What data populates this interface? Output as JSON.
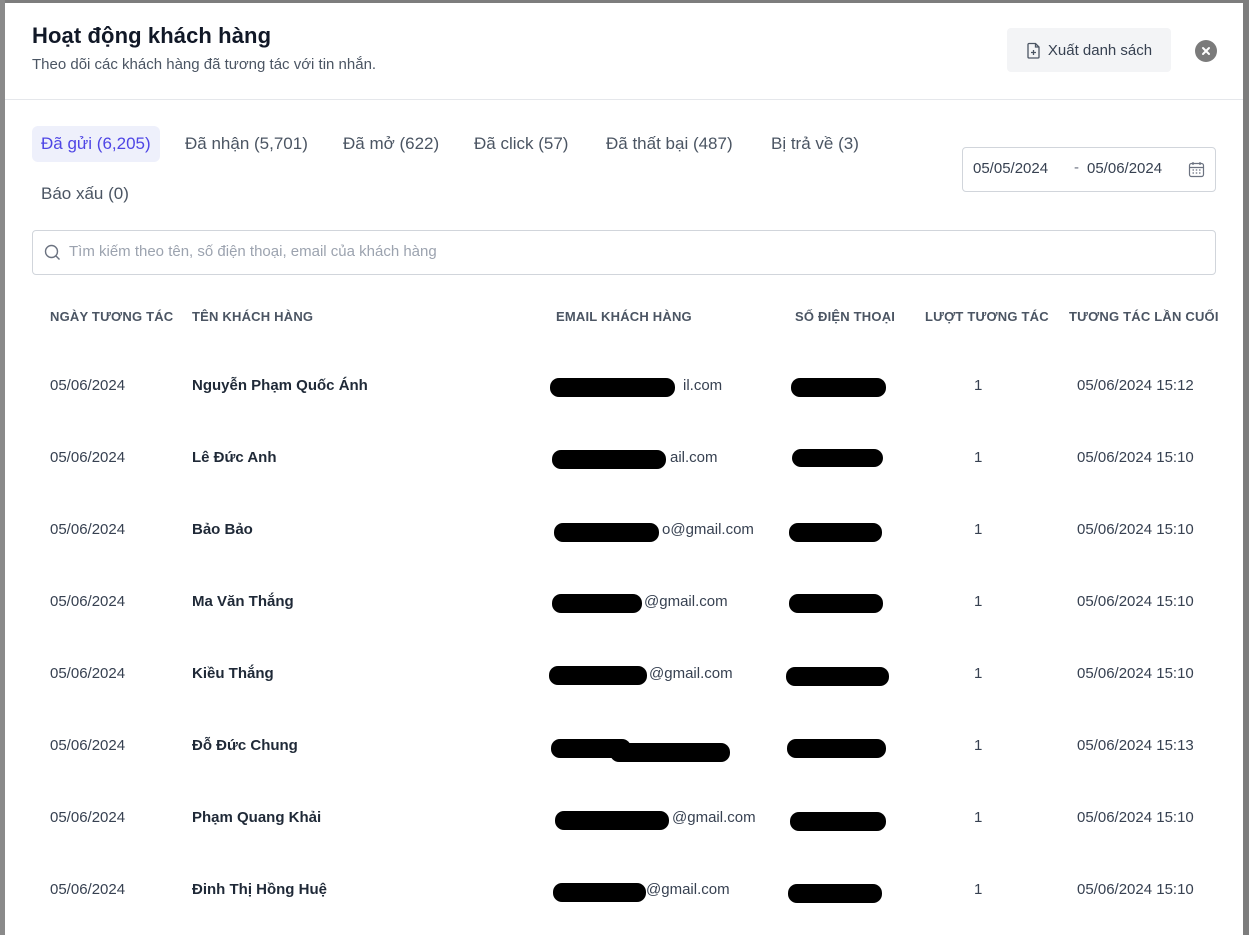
{
  "modal": {
    "title": "Hoạt động khách hàng",
    "subtitle": "Theo dõi các khách hàng đã tương tác với tin nhắn.",
    "export_label": "Xuất danh sách"
  },
  "tabs": [
    {
      "label": "Đã gửi (6,205)",
      "active": true
    },
    {
      "label": "Đã nhận (5,701)",
      "active": false
    },
    {
      "label": "Đã mở (622)",
      "active": false
    },
    {
      "label": "Đã click (57)",
      "active": false
    },
    {
      "label": "Đã thất bại (487)",
      "active": false
    },
    {
      "label": "Bị trả về (3)",
      "active": false
    },
    {
      "label": "Báo xấu (0)",
      "active": false
    }
  ],
  "date_range": {
    "from": "05/05/2024",
    "separator": "-",
    "to": "05/06/2024"
  },
  "search": {
    "placeholder": "Tìm kiếm theo tên, số điện thoại, email của khách hàng"
  },
  "table": {
    "headers": [
      "NGÀY TƯƠNG TÁC",
      "TÊN KHÁCH HÀNG",
      "EMAIL KHÁCH HÀNG",
      "SỐ ĐIỆN THOẠI",
      "LƯỢT TƯƠNG TÁC",
      "TƯƠNG TÁC LẦN CUỐI"
    ],
    "rows": [
      {
        "date": "05/06/2024",
        "name": "Nguyễn Phạm Quốc Ánh",
        "email_visible": "il.com",
        "phone_visible": "",
        "count": "1",
        "last": "05/06/2024 15:12"
      },
      {
        "date": "05/06/2024",
        "name": "Lê Đức Anh",
        "email_visible": "ail.com",
        "phone_visible": "",
        "count": "1",
        "last": "05/06/2024 15:10"
      },
      {
        "date": "05/06/2024",
        "name": "Bảo Bảo",
        "email_visible": "o@gmail.com",
        "phone_visible": "",
        "count": "1",
        "last": "05/06/2024 15:10"
      },
      {
        "date": "05/06/2024",
        "name": "Ma Văn Thắng",
        "email_visible": "@gmail.com",
        "phone_visible": "",
        "count": "1",
        "last": "05/06/2024 15:10"
      },
      {
        "date": "05/06/2024",
        "name": "Kiều Thắng",
        "email_visible": "@gmail.com",
        "phone_visible": "",
        "count": "1",
        "last": "05/06/2024 15:10"
      },
      {
        "date": "05/06/2024",
        "name": "Đỗ Đức Chung",
        "email_visible": "",
        "phone_visible": "",
        "count": "1",
        "last": "05/06/2024 15:13"
      },
      {
        "date": "05/06/2024",
        "name": "Phạm Quang Khải",
        "email_visible": "@gmail.com",
        "phone_visible": "",
        "count": "1",
        "last": "05/06/2024 15:10"
      },
      {
        "date": "05/06/2024",
        "name": "Đinh Thị Hồng Huệ",
        "email_visible": "@gmail.com",
        "phone_visible": "",
        "count": "1",
        "last": "05/06/2024 15:10"
      }
    ]
  },
  "colors": {
    "accent": "#4f46e5",
    "active_tab_bg": "#eef0fb",
    "backdrop": "#7d7d7d"
  },
  "icons": [
    "file-export-icon",
    "close-icon",
    "calendar-icon",
    "search-icon"
  ]
}
